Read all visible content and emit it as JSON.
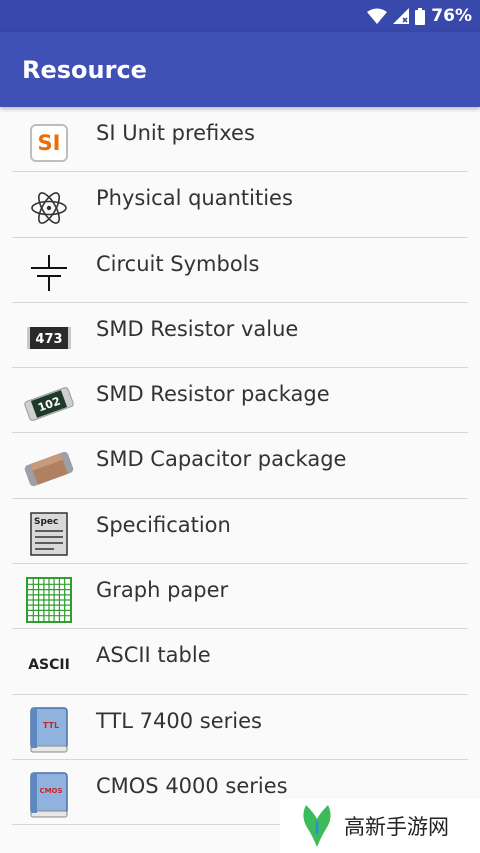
{
  "status_bar": {
    "battery": "76%",
    "wifi_icon": "wifi-icon",
    "signal_icon": "cell-signal-icon",
    "battery_icon": "battery-icon"
  },
  "app_bar": {
    "title": "Resource",
    "color": "#3f51b5"
  },
  "items": [
    {
      "label": "SI Unit prefixes",
      "icon": "si-prefix-icon",
      "icon_text": "SI"
    },
    {
      "label": "Physical quantities",
      "icon": "atom-icon"
    },
    {
      "label": "Circuit Symbols",
      "icon": "capacitor-symbol-icon"
    },
    {
      "label": "SMD Resistor value",
      "icon": "smd-resistor-value-icon",
      "icon_text": "473"
    },
    {
      "label": "SMD Resistor package",
      "icon": "smd-resistor-package-icon",
      "icon_text": "102"
    },
    {
      "label": "SMD Capacitor package",
      "icon": "smd-capacitor-package-icon"
    },
    {
      "label": "Specification",
      "icon": "spec-document-icon",
      "icon_text": "Spec"
    },
    {
      "label": "Graph paper",
      "icon": "graph-paper-icon"
    },
    {
      "label": "ASCII table",
      "icon": "ascii-icon",
      "icon_text": "ASCII"
    },
    {
      "label": "TTL 7400 series",
      "icon": "ttl-book-icon",
      "icon_text": "TTL"
    },
    {
      "label": "CMOS 4000 series",
      "icon": "cmos-book-icon",
      "icon_text": "CMOS"
    }
  ],
  "watermark": {
    "text": "高新手游网",
    "icon": "watermark-logo-icon"
  }
}
